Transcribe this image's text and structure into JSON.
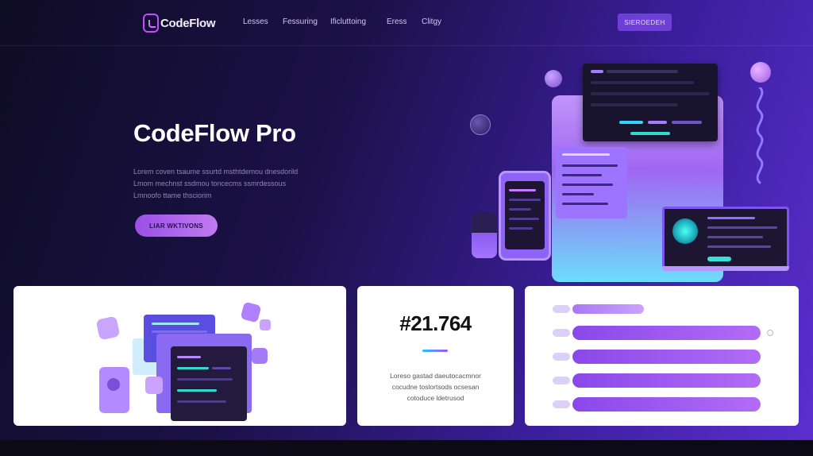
{
  "nav": {
    "logo_text": "CodeFlow",
    "links": [
      "Lesses",
      "Fessuring",
      "Ificluttoing",
      "Eress",
      "Clitgy"
    ],
    "cta_label": "SIEROEDEH"
  },
  "hero": {
    "title": "CodeFlow Pro",
    "body_lines": [
      "Lorem coven tsaume ssurtd msthtdemou dnesdorild",
      "Lmom mechnst ssdmou toncecms ssmrdessous",
      "Lmnoofo ttame thsciorim"
    ],
    "cta_label": "LIAR WKTIVONS"
  },
  "stat_card": {
    "value": "#21.764",
    "body_lines": [
      "Loreso gastad daeutocacmnor",
      "cocudne toslortsods ocsesan",
      "cotoduce ldetrusod"
    ]
  },
  "progress_card": {
    "bars": [
      0.38,
      1.0,
      1.0,
      1.0,
      1.0
    ]
  },
  "colors": {
    "accent": "#8a48ea",
    "accent_light": "#b26cf6",
    "cyan": "#29c3ff",
    "bg_dark": "#0f0c24"
  },
  "icons": {
    "logo": "code-bracket-icon"
  }
}
